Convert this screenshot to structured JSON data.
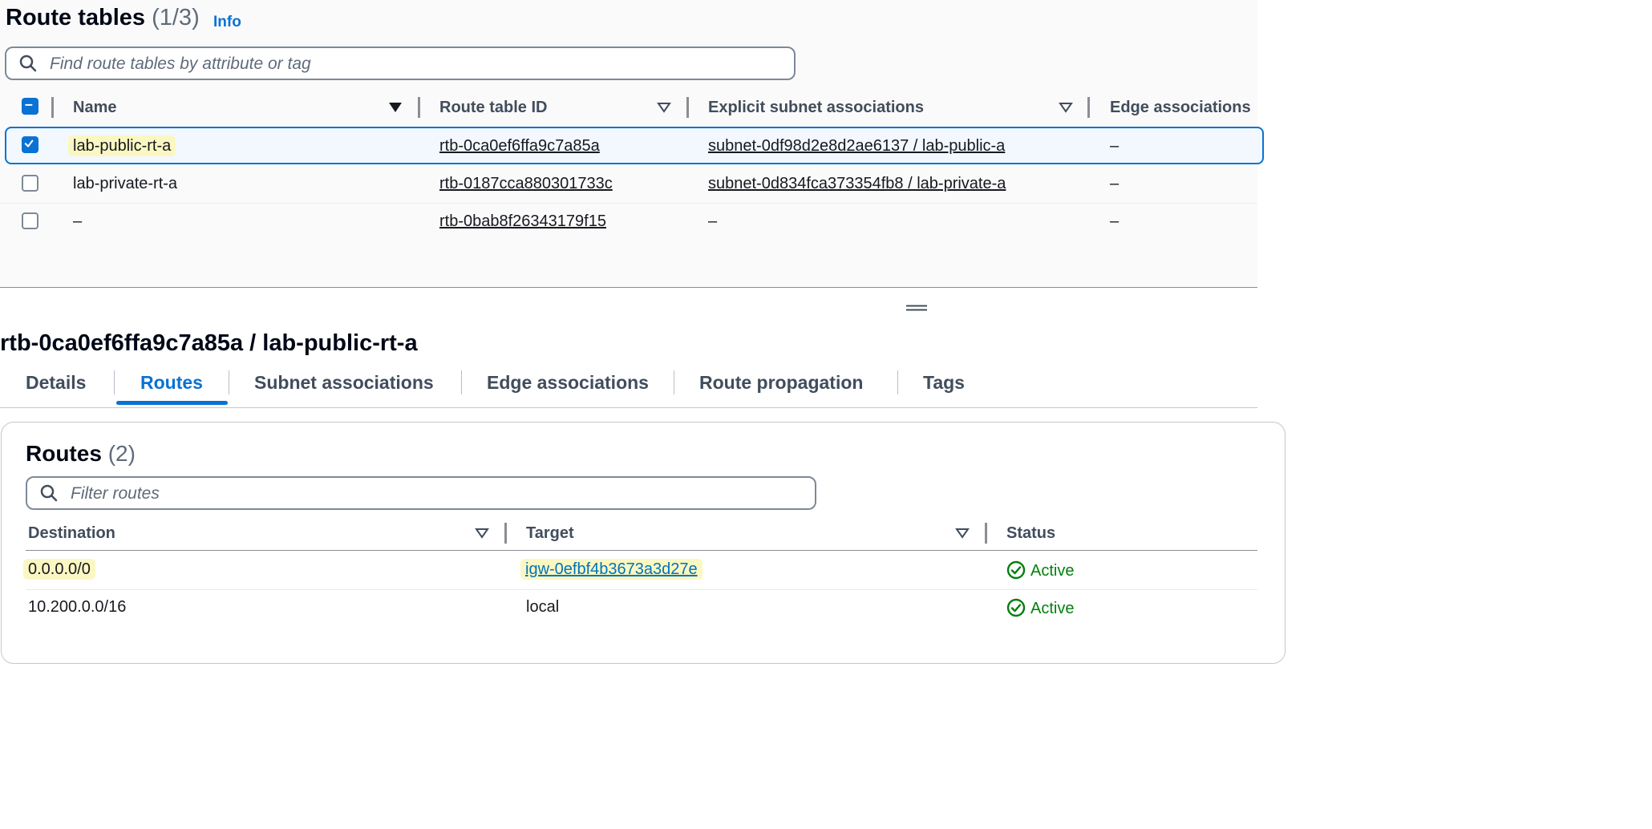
{
  "route_tables": {
    "title": "Route tables",
    "count": "(1/3)",
    "info_label": "Info",
    "search_placeholder": "Find route tables by attribute or tag",
    "columns": {
      "name": "Name",
      "route_table_id": "Route table ID",
      "explicit_subnet_associations": "Explicit subnet associations",
      "edge_associations": "Edge associations"
    },
    "rows": [
      {
        "name": "lab-public-rt-a",
        "id": "rtb-0ca0ef6ffa9c7a85a",
        "subnet": "subnet-0df98d2e8d2ae6137 / lab-public-a",
        "edge": "–",
        "selected": true
      },
      {
        "name": "lab-private-rt-a",
        "id": "rtb-0187cca880301733c",
        "subnet": "subnet-0d834fca373354fb8 / lab-private-a",
        "edge": "–",
        "selected": false
      },
      {
        "name": "–",
        "id": "rtb-0bab8f26343179f15",
        "subnet": "–",
        "edge": "–",
        "selected": false
      }
    ]
  },
  "detail": {
    "title": "rtb-0ca0ef6ffa9c7a85a / lab-public-rt-a",
    "tabs": [
      "Details",
      "Routes",
      "Subnet associations",
      "Edge associations",
      "Route propagation",
      "Tags"
    ],
    "active_tab": "Routes"
  },
  "routes": {
    "title": "Routes",
    "count": "(2)",
    "filter_placeholder": "Filter routes",
    "columns": {
      "destination": "Destination",
      "target": "Target",
      "status": "Status"
    },
    "rows": [
      {
        "destination": "0.0.0.0/0",
        "target": "igw-0efbf4b3673a3d27e",
        "status": "Active"
      },
      {
        "destination": "10.200.0.0/16",
        "target": "local",
        "status": "Active"
      }
    ]
  },
  "icons": {
    "search": "search-icon",
    "sort_desc": "sort-descending-icon",
    "sort": "sort-icon",
    "status_ok": "check-circle-icon",
    "drag": "drag-handle-icon"
  },
  "colors": {
    "accent": "#0972d3",
    "link": "#0073bb",
    "success": "#037f0c",
    "highlight": "#fbf7c2"
  }
}
